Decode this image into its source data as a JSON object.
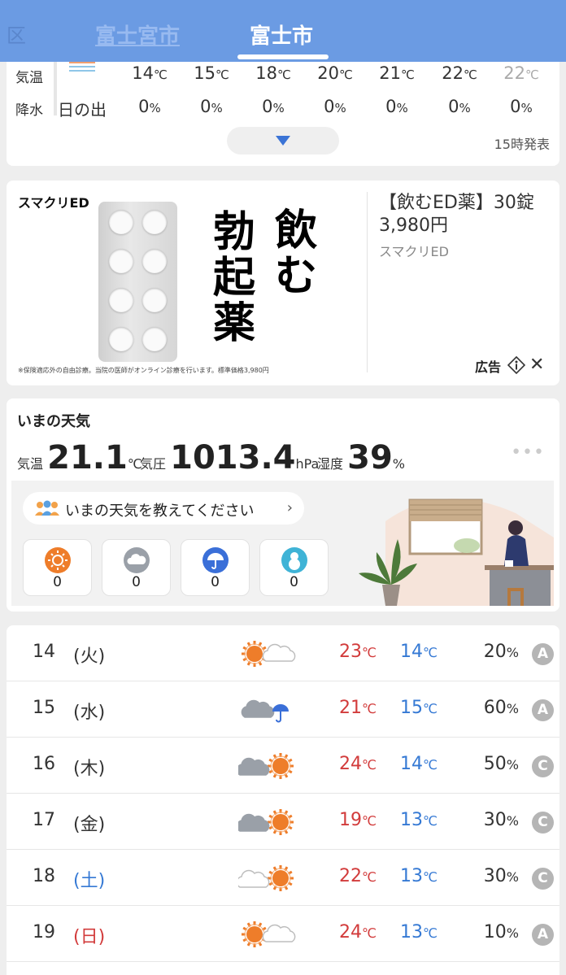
{
  "header": {
    "edge_label": "区",
    "tabs": [
      {
        "label": "富士宮市",
        "active": false
      },
      {
        "label": "富士市",
        "active": true
      }
    ]
  },
  "hourly": {
    "row_labels": {
      "temp": "気温",
      "precip": "降水"
    },
    "sunrise_label": "日の出",
    "temps": [
      "14",
      "15",
      "18",
      "20",
      "21",
      "22",
      "22"
    ],
    "temp_unit": "℃",
    "precip": [
      "0",
      "0",
      "0",
      "0",
      "0",
      "0",
      "0"
    ],
    "precip_unit": "%",
    "issued": "15時発表"
  },
  "ad": {
    "brand": "スマクリED",
    "headline_col1": "飲む",
    "headline_col2": "勃起薬",
    "fineprint": "※保険適応外の自由診療。当院の医師がオンライン診療を行います。標準価格3,980円",
    "title": "【飲むED薬】30錠3,980円",
    "sponsor": "スマクリED",
    "tag": "広告"
  },
  "current": {
    "title": "いまの天気",
    "temp_label": "気温",
    "temp_value": "21.1",
    "temp_unit": "℃",
    "pressure_label": "気圧",
    "pressure_value": "1013.4",
    "pressure_unit": "hPa",
    "humidity_label": "湿度",
    "humidity_value": "39",
    "humidity_unit": "%",
    "ask_text": "いまの天気を教えてください",
    "reports": [
      {
        "icon": "sun-icon",
        "count": "0",
        "color": "#ee7d2a"
      },
      {
        "icon": "cloud-icon",
        "count": "0",
        "color": "#9aa0a8"
      },
      {
        "icon": "umbrella-icon",
        "count": "0",
        "color": "#3a6fd8"
      },
      {
        "icon": "snowman-icon",
        "count": "0",
        "color": "#3fb3d6"
      }
    ]
  },
  "daily": [
    {
      "day": "14",
      "weekday": "(火)",
      "weekday_color": "#333333",
      "icon": "sunny-then-cloudy",
      "hi": "23",
      "lo": "14",
      "precip": "20",
      "grade": "A"
    },
    {
      "day": "15",
      "weekday": "(水)",
      "weekday_color": "#333333",
      "icon": "cloudy-then-rain",
      "hi": "21",
      "lo": "15",
      "precip": "60",
      "grade": "A"
    },
    {
      "day": "16",
      "weekday": "(木)",
      "weekday_color": "#333333",
      "icon": "cloudy-then-sunny",
      "hi": "24",
      "lo": "14",
      "precip": "50",
      "grade": "C"
    },
    {
      "day": "17",
      "weekday": "(金)",
      "weekday_color": "#333333",
      "icon": "cloudy-then-sunny",
      "hi": "19",
      "lo": "13",
      "precip": "30",
      "grade": "C"
    },
    {
      "day": "18",
      "weekday": "(土)",
      "weekday_color": "#3579d4",
      "icon": "light-cloud-then-sunny",
      "hi": "22",
      "lo": "13",
      "precip": "30",
      "grade": "C"
    },
    {
      "day": "19",
      "weekday": "(日)",
      "weekday_color": "#d23b3b",
      "icon": "sunny-then-cloudy",
      "hi": "24",
      "lo": "13",
      "precip": "10",
      "grade": "A"
    }
  ],
  "units": {
    "temp": "℃",
    "percent": "%"
  }
}
